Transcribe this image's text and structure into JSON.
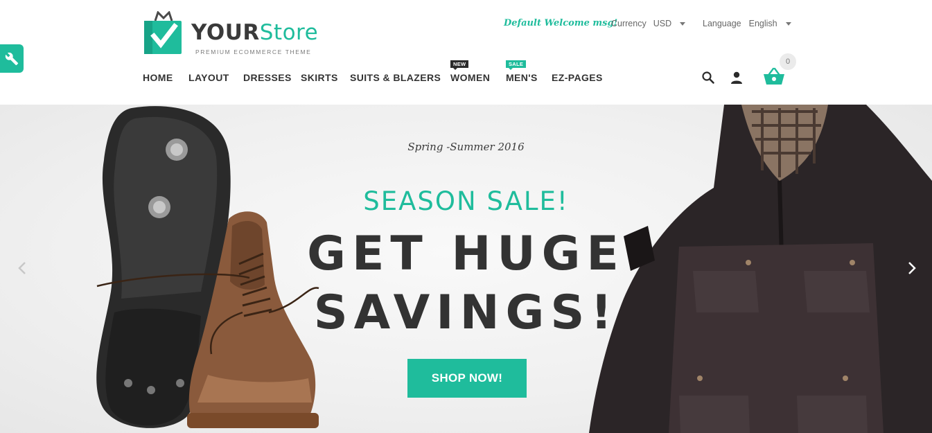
{
  "tool_tab": {
    "icon": "wrench-icon"
  },
  "logo": {
    "brand_part1": "YOUR",
    "brand_part2": "Store",
    "tagline": "PREMIUM ECOMMERCE THEME",
    "icon": "shopping-bag-check-icon"
  },
  "topbar": {
    "welcome": "Default Welcome msg!",
    "currency_label": "Currency",
    "currency_value": "USD",
    "language_label": "Language",
    "language_value": "English"
  },
  "nav": {
    "items": [
      {
        "label": "HOME"
      },
      {
        "label": "LAYOUT"
      },
      {
        "label": "DRESSES"
      },
      {
        "label": "SKIRTS"
      },
      {
        "label": "SUITS & BLAZERS"
      },
      {
        "label": "WOMEN",
        "badge": "NEW"
      },
      {
        "label": "MEN'S",
        "badge": "SALE"
      },
      {
        "label": "EZ-PAGES"
      }
    ]
  },
  "header_icons": {
    "search": "search-icon",
    "account": "user-icon",
    "cart": "basket-icon",
    "cart_count": "0"
  },
  "hero": {
    "subtitle": "Spring -Summer 2016",
    "headline_accent": "SEASON SALE!",
    "headline_line1": "GET HUGE",
    "headline_line2": "SAVINGS!",
    "cta": "SHOP NOW!"
  },
  "colors": {
    "accent": "#1fbc9c",
    "text_dark": "#333333",
    "badge_new": "#2b2b2b"
  }
}
